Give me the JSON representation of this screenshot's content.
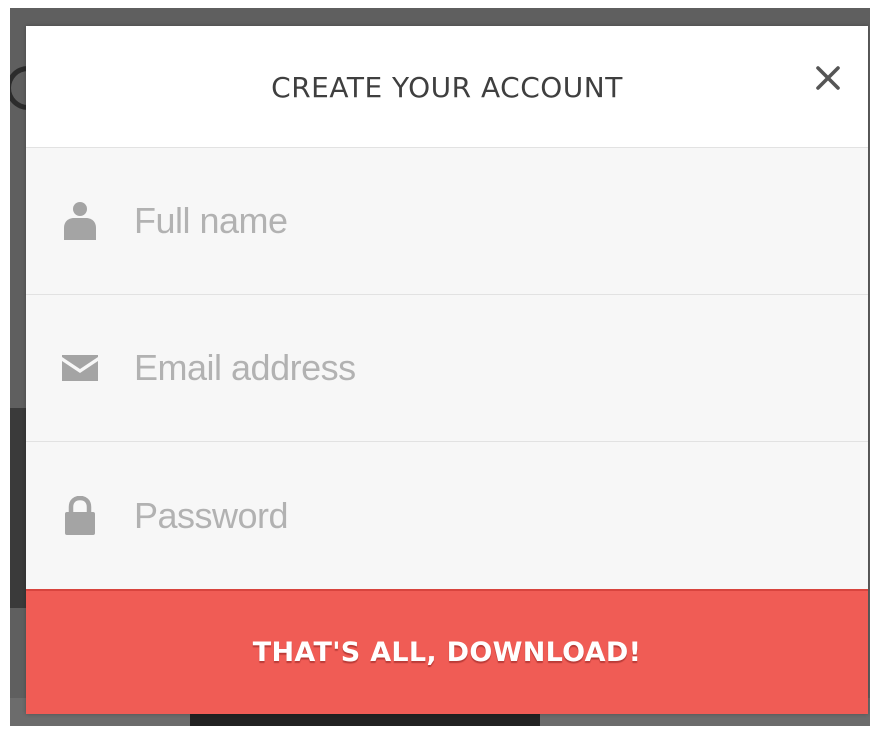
{
  "modal": {
    "title": "CREATE YOUR ACCOUNT",
    "close_icon": "close-icon"
  },
  "form": {
    "fields": [
      {
        "icon": "user-icon",
        "placeholder": "Full name",
        "value": ""
      },
      {
        "icon": "envelope-icon",
        "placeholder": "Email address",
        "value": ""
      },
      {
        "icon": "lock-icon",
        "placeholder": "Password",
        "value": ""
      }
    ],
    "submit_label": "THAT'S ALL, DOWNLOAD!"
  },
  "colors": {
    "accent": "#f05c55",
    "title_text": "#3f3f3f",
    "placeholder_text": "#b2b2b2",
    "icon": "#a4a4a4",
    "overlay": "#5f5f5f"
  }
}
